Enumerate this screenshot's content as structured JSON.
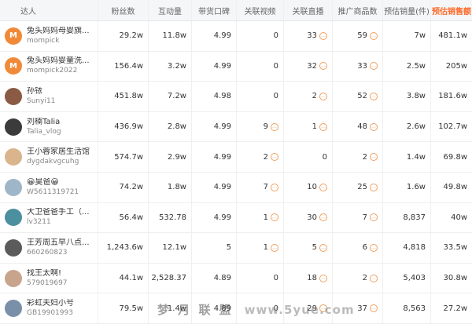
{
  "headers": {
    "influencer": "达人",
    "fans": "粉丝数",
    "interaction": "互动量",
    "score": "带货口碑",
    "videos": "关联视频",
    "lives": "关联直播",
    "goods": "推广商品数",
    "sales": "预估销量(件)",
    "amount": "预估销售额"
  },
  "accent_color": "#ff6a2a",
  "rows": [
    {
      "name": "兔头妈妈母婴旗...",
      "id": "mompick",
      "fans": "29.2w",
      "interaction": "11.8w",
      "score": "4.99",
      "videos": "0",
      "videos_dot": false,
      "lives": "33",
      "lives_dot": true,
      "goods": "59",
      "goods_dot": true,
      "sales": "7w",
      "amount": "481.1w",
      "avatar": "logo",
      "avatar_color": "#f08a38"
    },
    {
      "name": "兔头妈妈婴童洗...",
      "id": "mompick2022",
      "fans": "156.4w",
      "interaction": "3.2w",
      "score": "4.99",
      "videos": "0",
      "videos_dot": false,
      "lives": "32",
      "lives_dot": true,
      "goods": "33",
      "goods_dot": true,
      "sales": "2.5w",
      "amount": "205w",
      "avatar": "logo",
      "avatar_color": "#f08a38"
    },
    {
      "name": "孙铱",
      "id": "Sunyi11",
      "fans": "451.8w",
      "interaction": "7.2w",
      "score": "4.98",
      "videos": "0",
      "videos_dot": false,
      "lives": "2",
      "lives_dot": true,
      "goods": "52",
      "goods_dot": true,
      "sales": "3.8w",
      "amount": "181.6w",
      "avatar": "photo",
      "avatar_color": "#8a5a44"
    },
    {
      "name": "刘楠Talia",
      "id": "Talia_vlog",
      "fans": "436.9w",
      "interaction": "2.8w",
      "score": "4.99",
      "videos": "9",
      "videos_dot": true,
      "lives": "1",
      "lives_dot": true,
      "goods": "48",
      "goods_dot": true,
      "sales": "2.6w",
      "amount": "102.7w",
      "avatar": "photo",
      "avatar_color": "#3b3b3b"
    },
    {
      "name": "王小蓉家居生活馆",
      "id": "dygdakvgcuhg",
      "fans": "574.7w",
      "interaction": "2.9w",
      "score": "4.99",
      "videos": "2",
      "videos_dot": true,
      "lives": "0",
      "lives_dot": false,
      "goods": "2",
      "goods_dot": true,
      "sales": "1.4w",
      "amount": "69.8w",
      "avatar": "photo",
      "avatar_color": "#d9b48c"
    },
    {
      "name": "😀昊爸😀",
      "id": "W5611319721",
      "fans": "74.2w",
      "interaction": "1.8w",
      "score": "4.99",
      "videos": "7",
      "videos_dot": true,
      "lives": "10",
      "lives_dot": true,
      "goods": "25",
      "goods_dot": true,
      "sales": "1.6w",
      "amount": "49.8w",
      "avatar": "photo",
      "avatar_color": "#9fb6c8"
    },
    {
      "name": "大卫爸爸手工（...",
      "id": "lv3211",
      "fans": "56.4w",
      "interaction": "532.78",
      "score": "4.99",
      "videos": "1",
      "videos_dot": true,
      "lives": "30",
      "lives_dot": true,
      "goods": "7",
      "goods_dot": true,
      "sales": "8,837",
      "amount": "40w",
      "avatar": "photo",
      "avatar_color": "#4c8f9e"
    },
    {
      "name": "王芳周五早八点...",
      "id": "660260823",
      "fans": "1,243.6w",
      "interaction": "12.1w",
      "score": "5",
      "videos": "1",
      "videos_dot": true,
      "lives": "5",
      "lives_dot": true,
      "goods": "6",
      "goods_dot": true,
      "sales": "4,818",
      "amount": "33.5w",
      "avatar": "photo",
      "avatar_color": "#5b5b5b"
    },
    {
      "name": "找王太啊!",
      "id": "579019697",
      "fans": "44.1w",
      "interaction": "2,528.37",
      "score": "4.89",
      "videos": "0",
      "videos_dot": false,
      "lives": "18",
      "lives_dot": true,
      "goods": "2",
      "goods_dot": true,
      "sales": "5,403",
      "amount": "30.8w",
      "avatar": "photo",
      "avatar_color": "#c8a48c"
    },
    {
      "name": "彩虹夫妇小号",
      "id": "GB19901993",
      "fans": "79.5w",
      "interaction": "1.4w",
      "score": "4.89",
      "videos": "0",
      "videos_dot": false,
      "lives": "29",
      "lives_dot": true,
      "goods": "37",
      "goods_dot": true,
      "sales": "8,563",
      "amount": "27.2w",
      "avatar": "photo",
      "avatar_color": "#7a8fa8"
    }
  ],
  "watermark": {
    "text": "梦 月 联 盟",
    "site": "www.5yue.com"
  }
}
